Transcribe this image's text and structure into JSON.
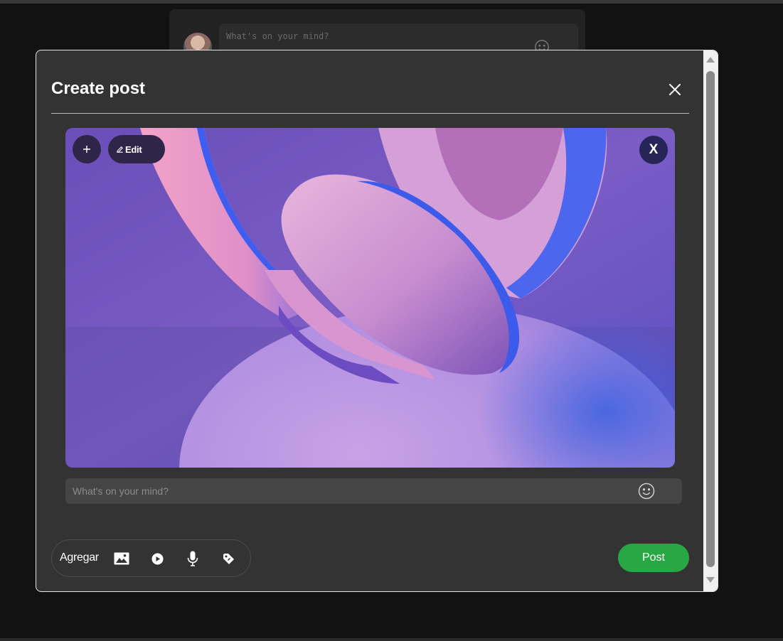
{
  "background_composer": {
    "placeholder": "What's on your mind?",
    "avatar_icon": "user-avatar",
    "emoji_icon": "smiley-icon"
  },
  "modal": {
    "title": "Create post",
    "close_icon": "close-icon",
    "media": {
      "add_icon": "plus-icon",
      "edit_label": "Edit",
      "edit_icon": "pencil-icon",
      "remove_label": "X",
      "image_subject": "pink headphones"
    },
    "input": {
      "placeholder": "What's on your mind?",
      "value": "",
      "emoji_icon": "smiley-icon"
    },
    "add_bar": {
      "label": "Agregar",
      "tools": [
        "image-icon",
        "play-icon",
        "microphone-icon",
        "tag-icon"
      ]
    },
    "post_label": "Post"
  },
  "colors": {
    "page_bg": "#121212",
    "modal_bg": "#333333",
    "media_button_bg": "#2e2548",
    "post_button": "#27a845"
  }
}
